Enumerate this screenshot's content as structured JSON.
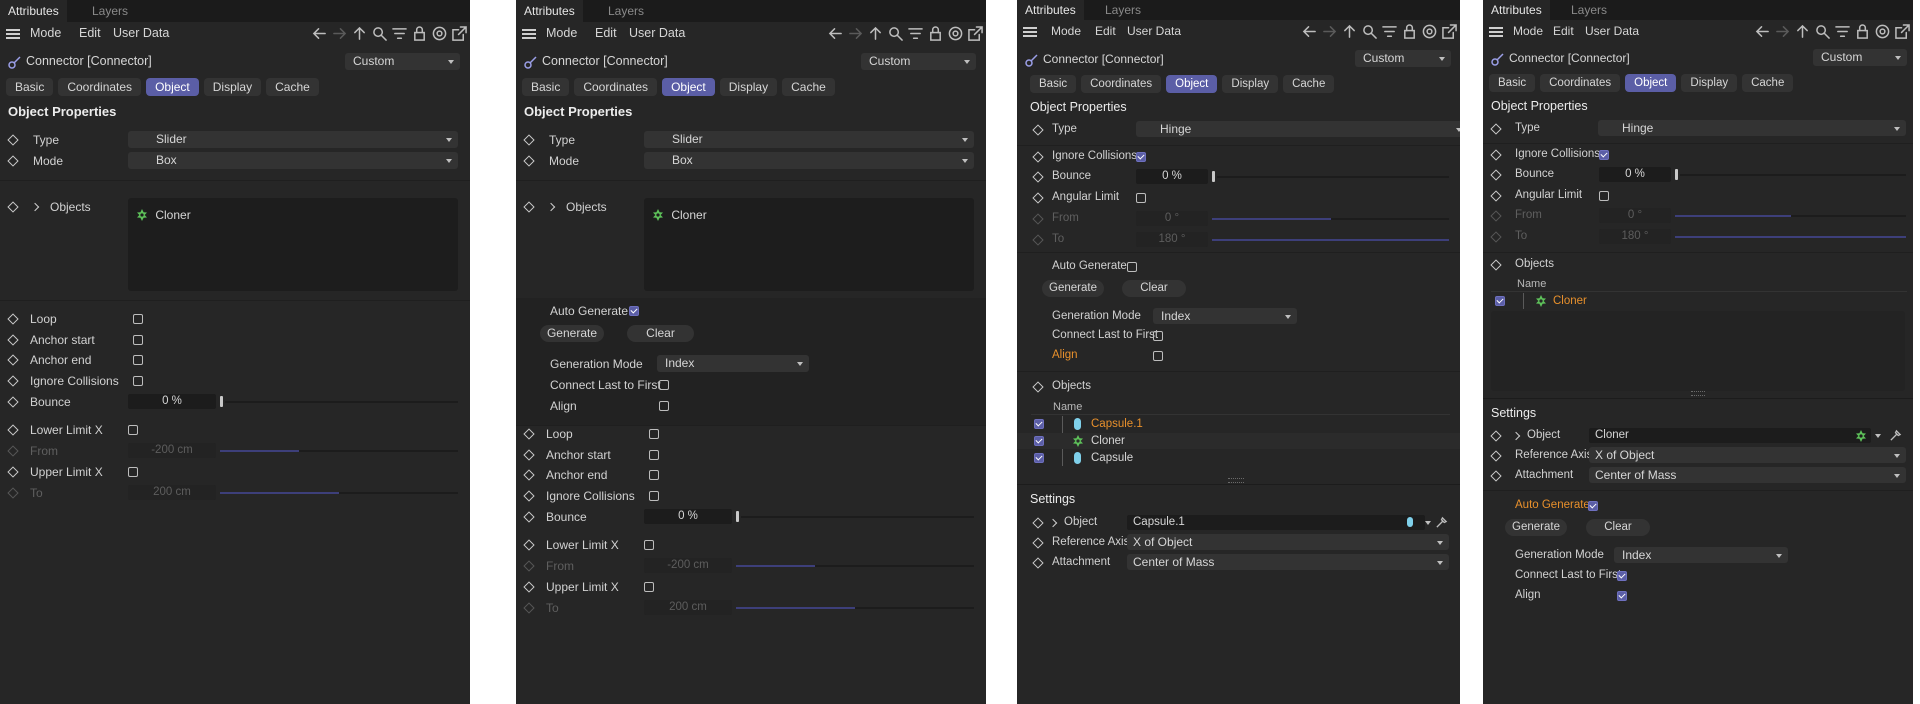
{
  "panels": [
    {
      "tabs": {
        "attributes": "Attributes",
        "layers": "Layers"
      },
      "menu": {
        "mode": "Mode",
        "edit": "Edit",
        "user_data": "User Data"
      },
      "object_title": "Connector [Connector]",
      "preset": "Custom",
      "pill_tabs": [
        "Basic",
        "Coordinates",
        "Object",
        "Display",
        "Cache"
      ],
      "section": "Object Properties",
      "type_label": "Type",
      "type_value": "Slider",
      "mode_label": "Mode",
      "mode_value": "Box",
      "objects_label": "Objects",
      "objects_item": "Cloner",
      "loop": "Loop",
      "anchor_start": "Anchor start",
      "anchor_end": "Anchor end",
      "ignore_collisions": "Ignore Collisions",
      "bounce_label": "Bounce",
      "bounce_value": "0 %",
      "lower_limit": "Lower Limit X",
      "from_label": "From",
      "from_value": "-200 cm",
      "upper_limit": "Upper Limit X",
      "to_label": "To",
      "to_value": "200 cm"
    },
    {
      "tabs": {
        "attributes": "Attributes",
        "layers": "Layers"
      },
      "menu": {
        "mode": "Mode",
        "edit": "Edit",
        "user_data": "User Data"
      },
      "object_title": "Connector [Connector]",
      "preset": "Custom",
      "pill_tabs": [
        "Basic",
        "Coordinates",
        "Object",
        "Display",
        "Cache"
      ],
      "section": "Object Properties",
      "type_label": "Type",
      "type_value": "Slider",
      "mode_label": "Mode",
      "mode_value": "Box",
      "objects_label": "Objects",
      "objects_item": "Cloner",
      "auto_generate": "Auto Generate",
      "generate_btn": "Generate",
      "clear_btn": "Clear",
      "generation_mode_label": "Generation Mode",
      "generation_mode_value": "Index",
      "connect_last": "Connect Last to First",
      "align": "Align",
      "loop": "Loop",
      "anchor_start": "Anchor start",
      "anchor_end": "Anchor end",
      "ignore_collisions": "Ignore Collisions",
      "bounce_label": "Bounce",
      "bounce_value": "0 %",
      "lower_limit": "Lower Limit X",
      "from_label": "From",
      "from_value": "-200 cm",
      "upper_limit": "Upper Limit X",
      "to_label": "To",
      "to_value": "200 cm"
    },
    {
      "tabs": {
        "attributes": "Attributes",
        "layers": "Layers"
      },
      "menu": {
        "mode": "Mode",
        "edit": "Edit",
        "user_data": "User Data"
      },
      "object_title": "Connector [Connector]",
      "preset": "Custom",
      "pill_tabs": [
        "Basic",
        "Coordinates",
        "Object",
        "Display",
        "Cache"
      ],
      "section": "Object Properties",
      "type_label": "Type",
      "type_value": "Hinge",
      "ignore_collisions": "Ignore Collisions",
      "bounce_label": "Bounce",
      "bounce_value": "0 %",
      "angular_limit": "Angular Limit",
      "from_label": "From",
      "from_value": "0 °",
      "to_label": "To",
      "to_value": "180 °",
      "auto_generate": "Auto Generate",
      "generate_btn": "Generate",
      "clear_btn": "Clear",
      "generation_mode_label": "Generation Mode",
      "generation_mode_value": "Index",
      "connect_last": "Connect Last to First",
      "align": "Align",
      "objects_label": "Objects",
      "name_header": "Name",
      "list": [
        "Capsule.1",
        "Cloner",
        "Capsule"
      ],
      "settings": "Settings",
      "object_label": "Object",
      "object_value": "Capsule.1",
      "ref_axis_label": "Reference Axis",
      "ref_axis_value": "X of Object",
      "attachment_label": "Attachment",
      "attachment_value": "Center of Mass"
    },
    {
      "tabs": {
        "attributes": "Attributes",
        "layers": "Layers"
      },
      "menu": {
        "mode": "Mode",
        "edit": "Edit",
        "user_data": "User Data"
      },
      "object_title": "Connector [Connector]",
      "preset": "Custom",
      "pill_tabs": [
        "Basic",
        "Coordinates",
        "Object",
        "Display",
        "Cache"
      ],
      "section": "Object Properties",
      "type_label": "Type",
      "type_value": "Hinge",
      "ignore_collisions": "Ignore Collisions",
      "bounce_label": "Bounce",
      "bounce_value": "0 %",
      "angular_limit": "Angular Limit",
      "from_label": "From",
      "from_value": "0 °",
      "to_label": "To",
      "to_value": "180 °",
      "objects_label": "Objects",
      "name_header": "Name",
      "list": [
        "Cloner"
      ],
      "settings": "Settings",
      "object_label": "Object",
      "object_value": "Cloner",
      "ref_axis_label": "Reference Axis",
      "ref_axis_value": "X of Object",
      "attachment_label": "Attachment",
      "attachment_value": "Center of Mass",
      "auto_generate": "Auto Generate",
      "generate_btn": "Generate",
      "clear_btn": "Clear",
      "generation_mode_label": "Generation Mode",
      "generation_mode_value": "Index",
      "connect_last": "Connect Last to First",
      "align": "Align"
    }
  ],
  "colors": {
    "accent": "#5b5ea6",
    "highlight": "#e8902c",
    "panel_bg": "#262626"
  },
  "icons": [
    "menu-icon",
    "back-arrow-icon",
    "forward-arrow-icon",
    "up-arrow-icon",
    "search-icon",
    "filter-icon",
    "lock-icon",
    "target-icon",
    "new-window-icon",
    "connector-icon",
    "cloner-icon",
    "capsule-icon",
    "keyframe-diamond-icon",
    "pick-icon"
  ]
}
